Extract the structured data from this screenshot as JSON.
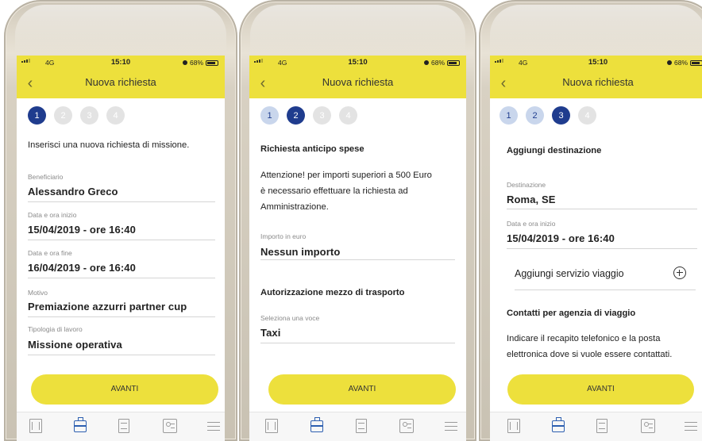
{
  "status": {
    "network": "4G",
    "time": "15:10",
    "battery": "68%"
  },
  "nav": {
    "title": "Nuova richiesta"
  },
  "actions": {
    "avanti": "AVANTI"
  },
  "screens": [
    {
      "steps": [
        "1",
        "2",
        "3",
        "4"
      ],
      "intro": "Inserisci una nuova richiesta di missione.",
      "fields": [
        {
          "label": "Beneficiario",
          "value": "Alessandro Greco"
        },
        {
          "label": "Data e ora inizio",
          "value": "15/04/2019 - ore 16:40"
        },
        {
          "label": "Data e ora fine",
          "value": "16/04/2019 - ore 16:40"
        },
        {
          "label": "Motivo",
          "value": "Premiazione azzurri partner cup"
        },
        {
          "label": "Tipologia di lavoro",
          "value": "Missione operativa"
        }
      ]
    },
    {
      "steps": [
        "1",
        "2",
        "3",
        "4"
      ],
      "section1": "Richiesta anticipo spese",
      "warning": [
        "Attenzione! per importi superiori a 500 Euro",
        "è necessario effettuare la richiesta ad",
        "Amministrazione."
      ],
      "amount": {
        "label": "Importo in euro",
        "value": "Nessun importo"
      },
      "section2": "Autorizzazione mezzo di trasporto",
      "transport": {
        "label": "Seleziona una voce",
        "value": "Taxi"
      }
    },
    {
      "steps": [
        "1",
        "2",
        "3",
        "4"
      ],
      "section1": "Aggiungi destinazione",
      "destination": {
        "label": "Destinazione",
        "value": "Roma, SE"
      },
      "start": {
        "label": "Data e ora inizio",
        "value": "15/04/2019 - ore 16:40"
      },
      "add_service": "Aggiungi servizio viaggio",
      "section2": "Contatti per agenzia di viaggio",
      "contacts_text": [
        "Indicare il recapito telefonico e la posta",
        "elettronica dove si vuole essere contattati."
      ]
    }
  ],
  "tabbar": [
    "book-icon",
    "briefcase-icon",
    "document-icon",
    "id-card-icon",
    "menu-icon"
  ],
  "colors": {
    "accent_yellow": "#ede03c",
    "step_blue": "#1f3c8e",
    "step_done": "#c9d6ec"
  }
}
